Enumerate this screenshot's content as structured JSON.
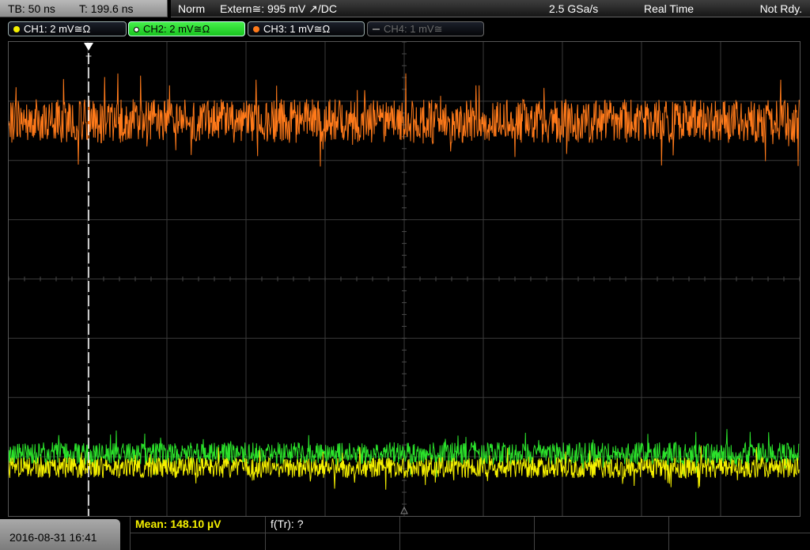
{
  "timebase": {
    "tb": "TB: 50 ns",
    "trigger_time": "T: 199.6 ns"
  },
  "status": {
    "mode": "Norm",
    "trigger_source": "Extern≅: 995 mV ↗/DC",
    "sample_rate": "2.5 GSa/s",
    "acq_mode": "Real Time",
    "state": "Not Rdy."
  },
  "channels": [
    {
      "label": "CH1: 2 mV≅Ω",
      "color": "#f5f000",
      "state": "on"
    },
    {
      "label": "CH2: 2 mV≅Ω",
      "color": "#2be22b",
      "state": "active"
    },
    {
      "label": "CH3: 1 mV≅Ω",
      "color": "#ff7a1a",
      "state": "on"
    },
    {
      "label": "CH4: 1 mV≅",
      "color": "#777777",
      "state": "off"
    }
  ],
  "trigger_marker": "T",
  "date": "2016-08-31 16:41",
  "measurements": [
    {
      "label": "Mean: 148.10 µV",
      "color": "#f5f000"
    },
    {
      "label": "f(Tr): ?",
      "color": "#ffffff"
    }
  ],
  "trace_colors": {
    "ch1": "#f5f000",
    "ch2": "#2be22b",
    "ch3": "#ff7a1a"
  }
}
